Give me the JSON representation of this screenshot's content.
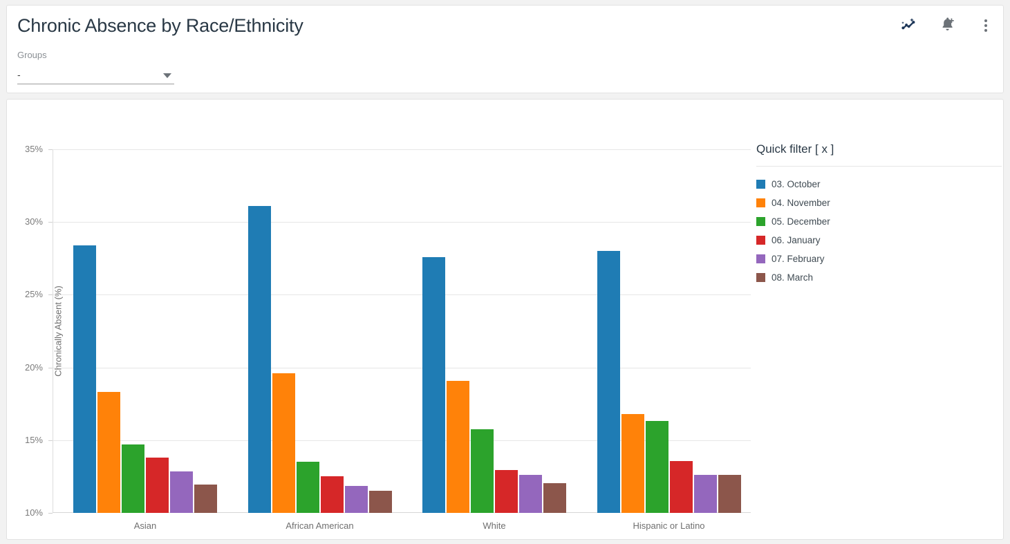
{
  "header": {
    "title": "Chronic Absence by Race/Ethnicity",
    "toolbar": [
      {
        "name": "insights-icon",
        "label": "Insights",
        "color": "#1c3557"
      },
      {
        "name": "add-alert-icon",
        "label": "Add alert",
        "color": "#6c7278"
      },
      {
        "name": "more-options-icon",
        "label": "More options",
        "color": "#6c7278"
      }
    ]
  },
  "filters": {
    "groups_label": "Groups",
    "groups_value": "-",
    "groups_caret": "chevron-down-icon"
  },
  "legend": {
    "title": "Quick filter [ x ]"
  },
  "chart_data": {
    "type": "bar",
    "title": "Chronic Absence by Race/Ethnicity",
    "xlabel": "",
    "ylabel": "Chronically Absent (%)",
    "ylim": [
      10,
      35
    ],
    "yticks": [
      10,
      15,
      20,
      25,
      30,
      35
    ],
    "ytick_labels": [
      "10%",
      "15%",
      "20%",
      "25%",
      "30%",
      "35%"
    ],
    "grid": true,
    "legend_position": "right",
    "categories": [
      "Asian",
      "African American",
      "White",
      "Hispanic or Latino"
    ],
    "series": [
      {
        "name": "03. October",
        "color": "#1f7cb4",
        "values": [
          28.4,
          31.1,
          27.6,
          28.0
        ]
      },
      {
        "name": "04. November",
        "color": "#ff8209",
        "values": [
          18.3,
          19.6,
          19.1,
          16.8
        ]
      },
      {
        "name": "05. December",
        "color": "#2ca32c",
        "values": [
          14.7,
          13.5,
          15.75,
          16.3
        ]
      },
      {
        "name": "06. January",
        "color": "#d62728",
        "values": [
          13.8,
          12.5,
          12.95,
          13.55
        ]
      },
      {
        "name": "07. February",
        "color": "#9467bd",
        "values": [
          12.85,
          11.85,
          12.6,
          12.6
        ]
      },
      {
        "name": "08. March",
        "color": "#8c564b",
        "values": [
          11.95,
          11.5,
          12.05,
          12.6
        ]
      }
    ]
  }
}
